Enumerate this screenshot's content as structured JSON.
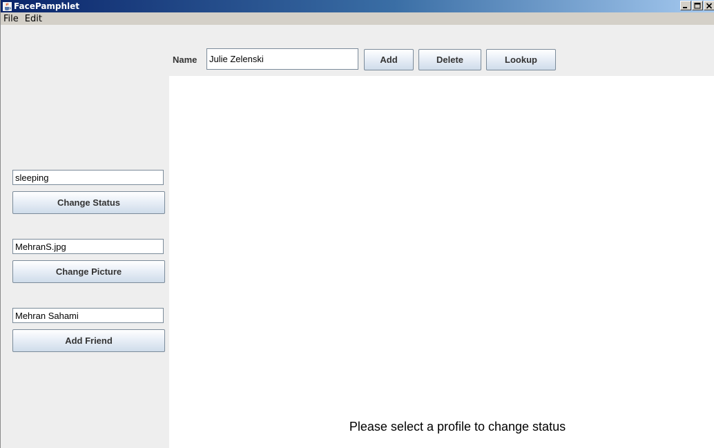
{
  "window": {
    "title": "FacePamphlet",
    "controls": {
      "minimize": "_",
      "maximize": "□",
      "close": "×"
    }
  },
  "menubar": {
    "items": [
      "File",
      "Edit"
    ]
  },
  "toolbar": {
    "name_label": "Name",
    "name_value": "Julie Zelenski",
    "add_label": "Add",
    "delete_label": "Delete",
    "lookup_label": "Lookup"
  },
  "sidebar": {
    "status_value": "sleeping",
    "change_status_label": "Change Status",
    "picture_value": "MehranS.jpg",
    "change_picture_label": "Change Picture",
    "friend_value": "Mehran Sahami",
    "add_friend_label": "Add Friend"
  },
  "canvas": {
    "message": "Please select a profile to change status"
  },
  "colors": {
    "titlebar_start": "#0a246a",
    "titlebar_end": "#a6caf0",
    "button_gradient_top": "#ffffff",
    "button_gradient_bottom": "#cfdcea"
  },
  "icons": {
    "app": "java-coffee-icon"
  }
}
